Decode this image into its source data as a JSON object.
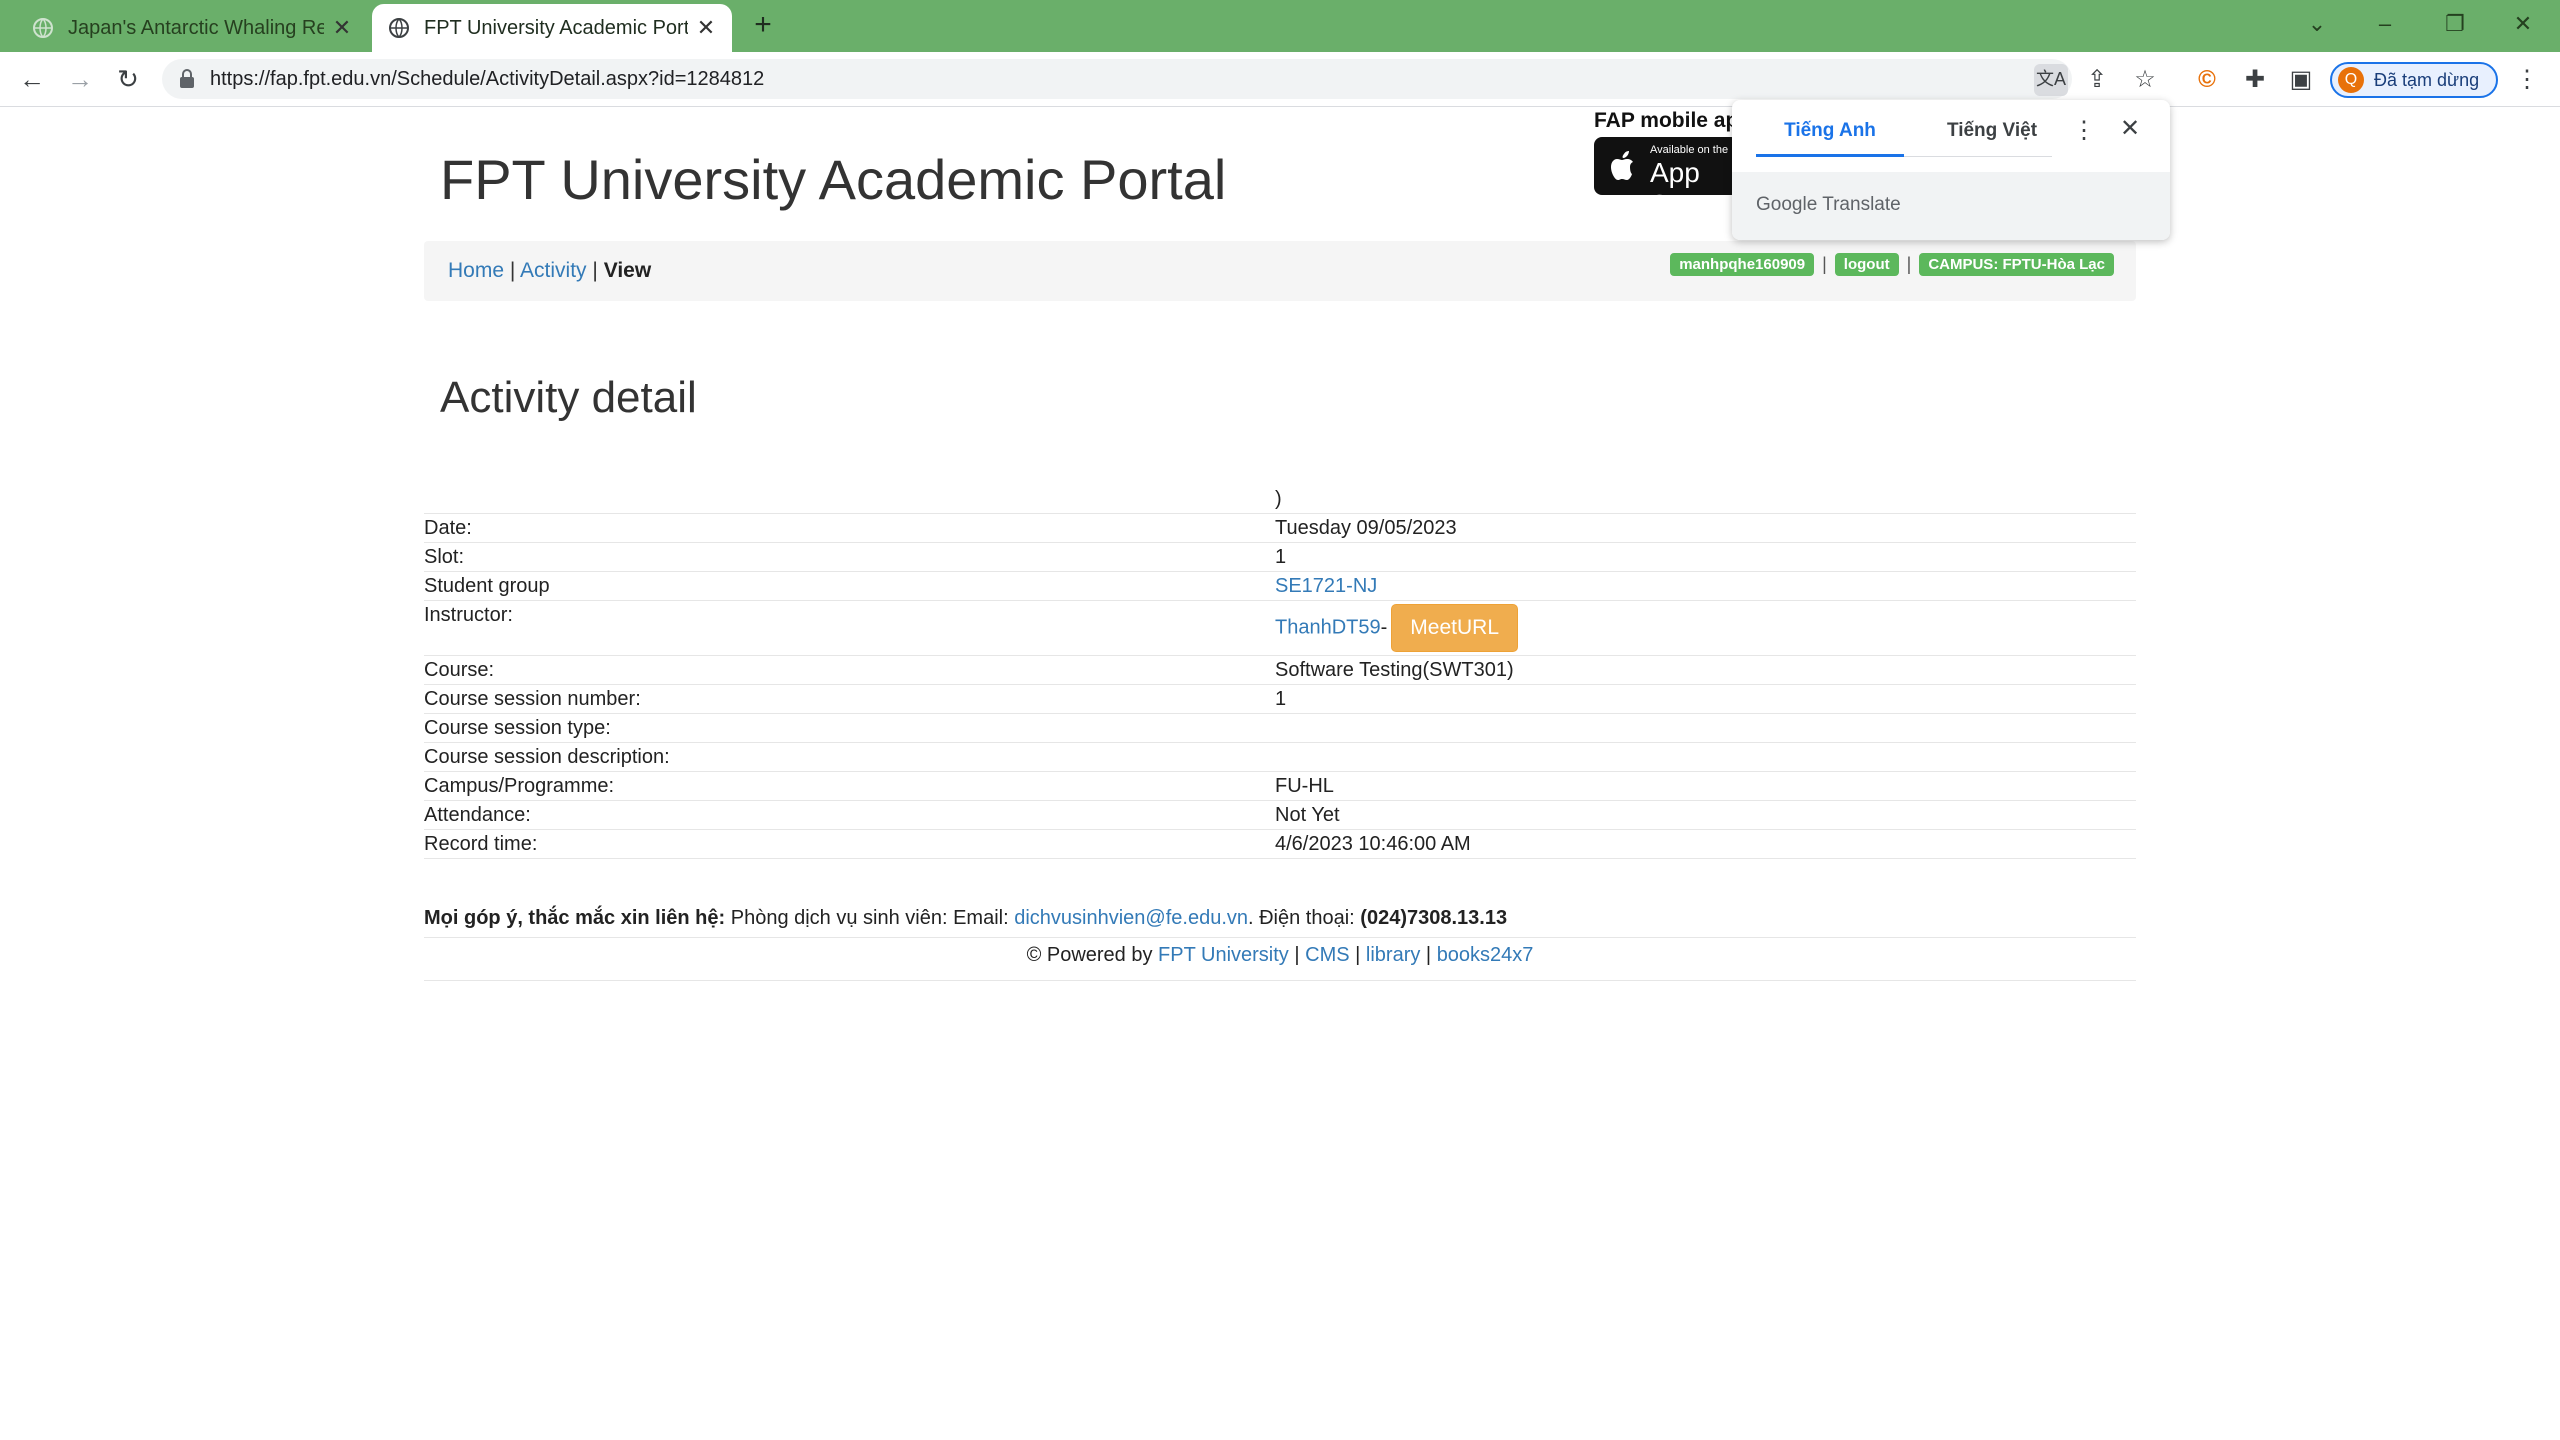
{
  "browser": {
    "tabs": [
      {
        "title": "Japan's Antarctic Whaling Resear",
        "active": false
      },
      {
        "title": "FPT University Academic Portal",
        "active": true
      }
    ],
    "url": "https://fap.fpt.edu.vn/Schedule/ActivityDetail.aspx?id=1284812",
    "profile_label": "Đã tạm dừng",
    "profile_initial": "Q"
  },
  "translate_popup": {
    "tab_source": "Tiếng Anh",
    "tab_target": "Tiếng Việt",
    "brand": "Google Translate"
  },
  "header": {
    "site_title": "FPT University Academic Portal",
    "mobile_label": "FAP mobile app",
    "appstore_small": "Available on the",
    "appstore_big": "App Store"
  },
  "breadcrumb": {
    "home": "Home",
    "activity": "Activity",
    "current": "View",
    "sep": "|"
  },
  "user_badges": {
    "username": "manhpqhe160909",
    "logout": "logout",
    "campus": "CAMPUS: FPTU-Hòa Lạc"
  },
  "page_heading": "Activity detail",
  "detail": {
    "top_value": ")",
    "rows": {
      "date": {
        "label": "Date:",
        "value": "Tuesday 09/05/2023"
      },
      "slot": {
        "label": "Slot:",
        "value": "1"
      },
      "group": {
        "label": "Student group",
        "value": "SE1721-NJ"
      },
      "instructor": {
        "label": "Instructor:",
        "value": "ThanhDT59",
        "dash": "-",
        "meet": "MeetURL"
      },
      "course": {
        "label": "Course:",
        "value": "Software Testing(SWT301)"
      },
      "session_number": {
        "label": "Course session number:",
        "value": "1"
      },
      "session_type": {
        "label": "Course session type:",
        "value": ""
      },
      "session_desc": {
        "label": "Course session description:",
        "value": ""
      },
      "campus": {
        "label": "Campus/Programme:",
        "value": "FU-HL"
      },
      "attendance": {
        "label": "Attendance:",
        "value": "Not Yet"
      },
      "record": {
        "label": "Record time:",
        "value": "4/6/2023 10:46:00 AM"
      }
    }
  },
  "footer": {
    "contact_bold": "Mọi góp ý, thắc mắc xin liên hệ:",
    "contact_text": " Phòng dịch vụ sinh viên: Email: ",
    "email": "dichvusinhvien@fe.edu.vn",
    "phone_text": ". Điện thoại: ",
    "phone": "(024)7308.13.13",
    "powered": "© Powered by ",
    "links": {
      "fpt": "FPT University",
      "cms": "CMS",
      "library": "library",
      "books": "books24x7"
    },
    "pipe": "|"
  }
}
